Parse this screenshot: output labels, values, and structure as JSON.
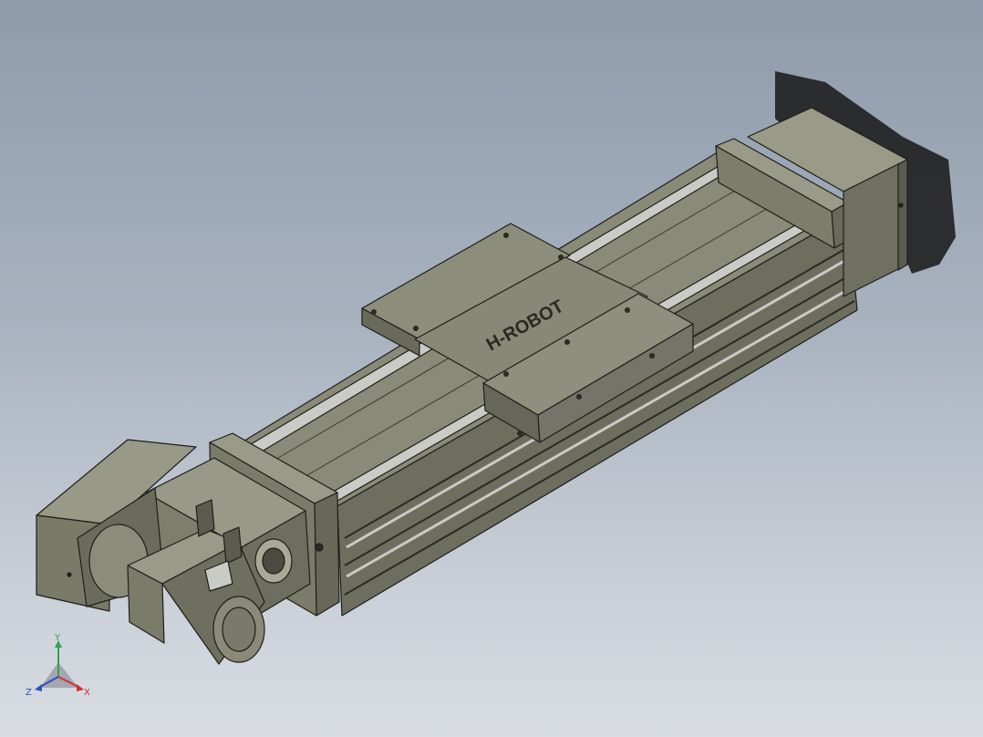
{
  "viewport": {
    "background_top": "#8f9bab",
    "background_bottom": "#d9dde3"
  },
  "model": {
    "brand_text": "H-ROBOT",
    "body_color": "#7a7a6a",
    "body_dark": "#55554a",
    "body_light": "#a3a392",
    "rail_color": "#c9cbc7",
    "edge_color": "#1e1e1a"
  },
  "triad": {
    "x_label": "X",
    "y_label": "Y",
    "z_label": "Z",
    "x_color": "#d0312d",
    "y_color": "#2fa34a",
    "z_color": "#2a52be"
  }
}
